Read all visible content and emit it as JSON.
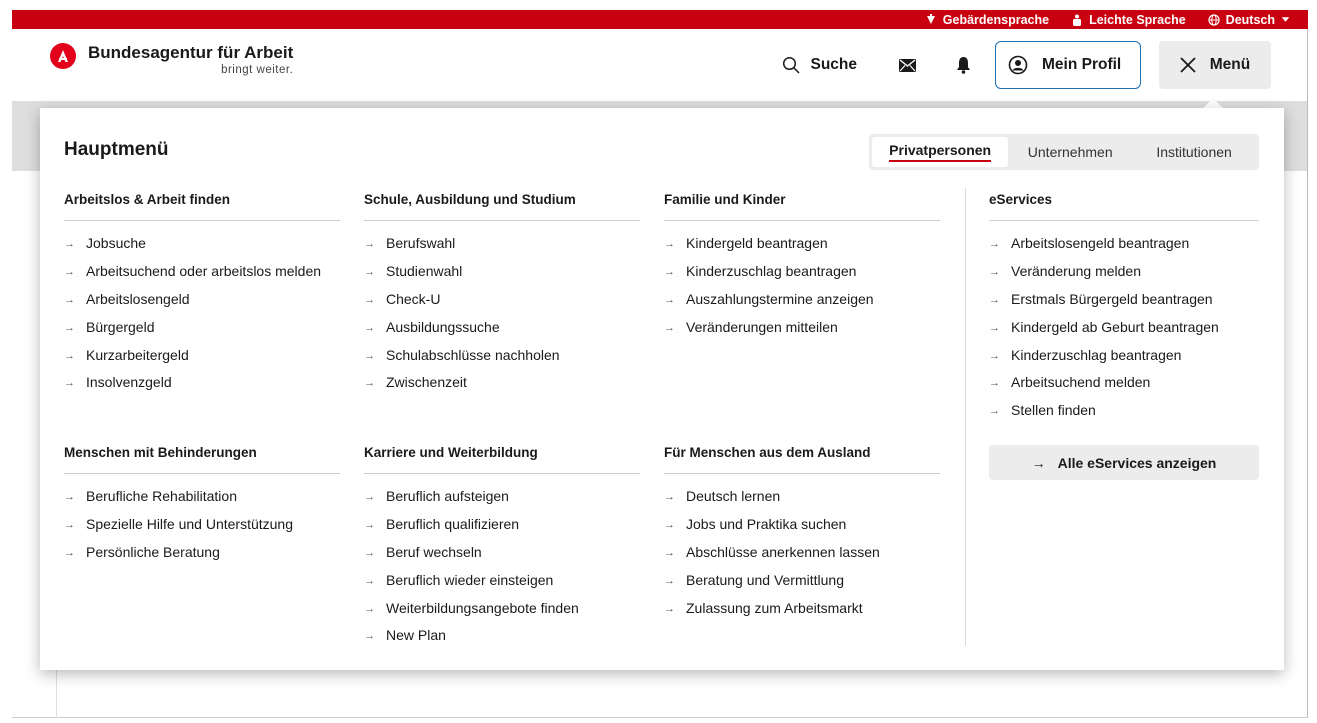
{
  "topbar": {
    "sign_language": "Gebärdensprache",
    "easy_language": "Leichte Sprache",
    "language": "Deutsch"
  },
  "header": {
    "brand": "Bundesagentur für Arbeit",
    "tagline": "bringt weiter.",
    "search_label": "Suche",
    "profile_label": "Mein Profil",
    "menu_label": "Menü"
  },
  "menu": {
    "title": "Hauptmenü",
    "audience_tabs": [
      "Privatpersonen",
      "Unternehmen",
      "Institutionen"
    ],
    "active_tab": "Privatpersonen",
    "sections": [
      {
        "heading": "Arbeitslos & Arbeit finden",
        "links": [
          "Jobsuche",
          "Arbeitsuchend oder arbeitslos melden",
          "Arbeitslosengeld",
          "Bürgergeld",
          "Kurzarbeitergeld",
          "Insolvenzgeld"
        ]
      },
      {
        "heading": "Schule, Ausbildung und Studium",
        "links": [
          "Berufswahl",
          "Studienwahl",
          "Check-U",
          "Ausbildungssuche",
          "Schulabschlüsse nachholen",
          "Zwischenzeit"
        ]
      },
      {
        "heading": "Familie und Kinder",
        "links": [
          "Kindergeld beantragen",
          "Kinderzuschlag beantragen",
          "Auszahlungstermine anzeigen",
          "Veränderungen mitteilen"
        ]
      },
      {
        "heading": "Menschen mit Behinderungen",
        "links": [
          "Berufliche Rehabilitation",
          "Spezielle Hilfe und Unterstützung",
          "Persönliche Beratung"
        ]
      },
      {
        "heading": "Karriere und Weiterbildung",
        "links": [
          "Beruflich aufsteigen",
          "Beruflich qualifizieren",
          "Beruf wechseln",
          "Beruflich wieder einsteigen",
          "Weiterbildungsangebote finden",
          "New Plan"
        ]
      },
      {
        "heading": "Für Menschen aus dem Ausland",
        "links": [
          "Deutsch lernen",
          "Jobs und Praktika suchen",
          "Abschlüsse anerkennen lassen",
          "Beratung und Vermittlung",
          "Zulassung zum Arbeitsmarkt"
        ]
      }
    ],
    "eservices": {
      "heading": "eServices",
      "links": [
        "Arbeitslosengeld beantragen",
        "Veränderung melden",
        "Erstmals Bürgergeld beantragen",
        "Kindergeld ab Geburt beantragen",
        "Kinderzuschlag beantragen",
        "Arbeitsuchend melden",
        "Stellen finden"
      ],
      "all_button": "Alle eServices anzeigen"
    }
  },
  "colors": {
    "brand_red": "#c8000f",
    "profile_border": "#1f6db3"
  }
}
